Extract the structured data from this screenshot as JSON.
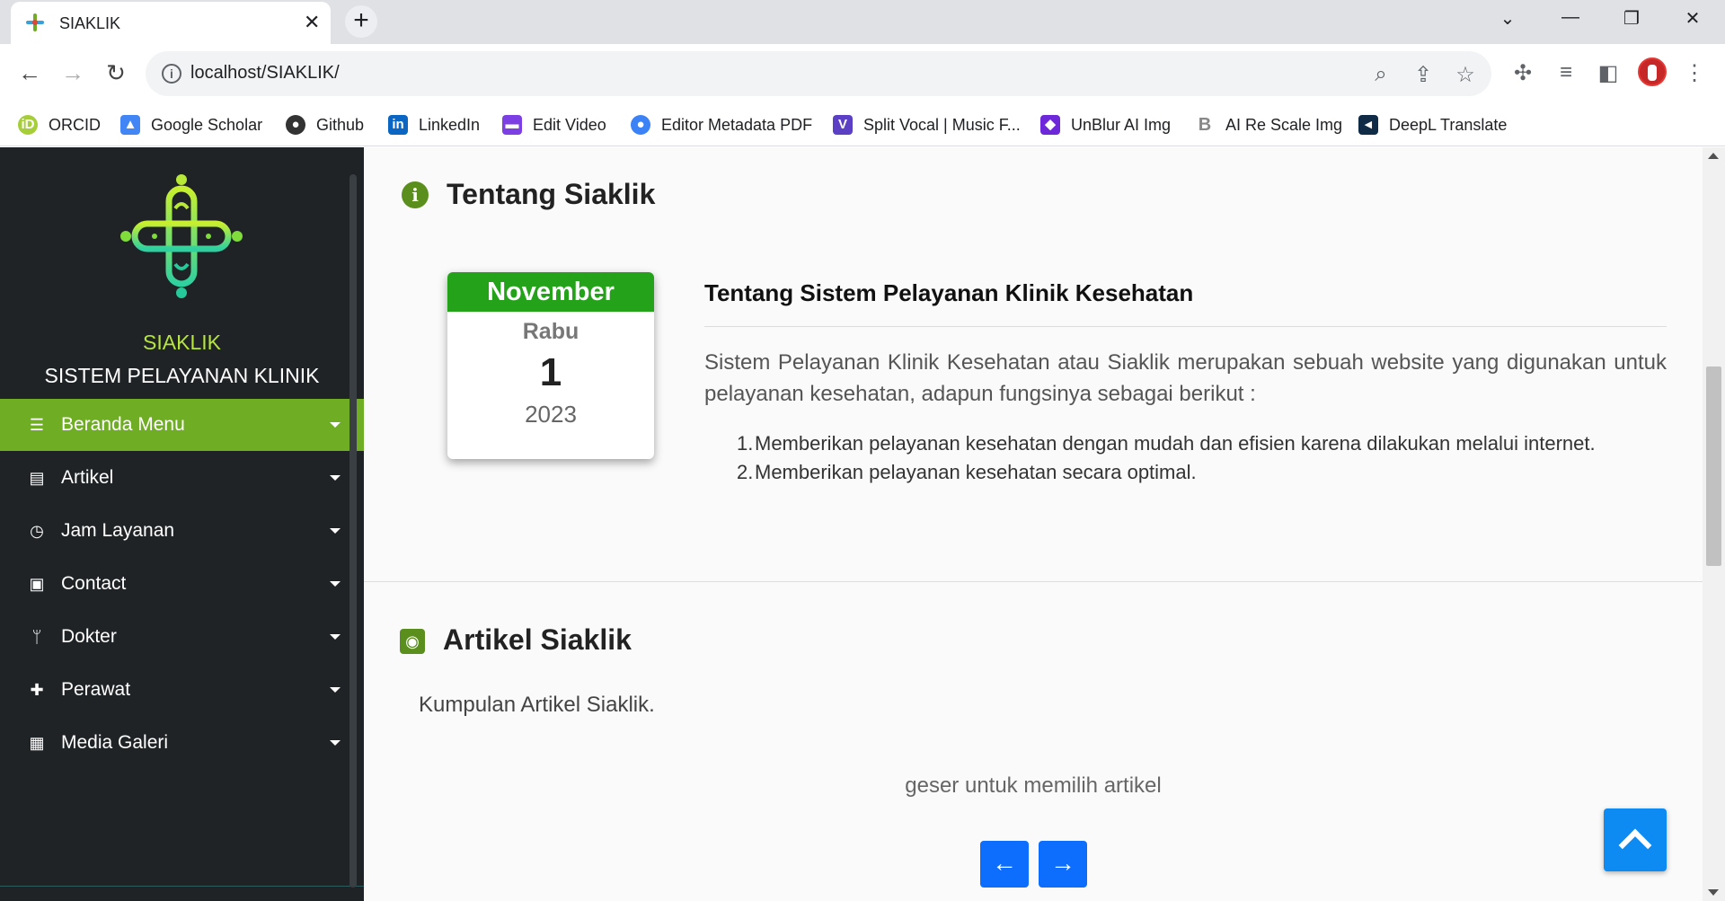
{
  "browser": {
    "tab_title": "SIAKLIK",
    "tab_close": "✕",
    "new_tab": "+",
    "url": "localhost/SIAKLIK/",
    "window_controls": {
      "minimize": "—",
      "restore": "❐",
      "close": "✕",
      "dropdown": "⌄"
    },
    "bookmarks": [
      {
        "label": "ORCID",
        "icon": "orcid-icon",
        "color": "#a6ce39"
      },
      {
        "label": "Google Scholar",
        "icon": "google-scholar-icon",
        "color": "#4285f4"
      },
      {
        "label": "Github",
        "icon": "github-icon",
        "color": "#333333"
      },
      {
        "label": "LinkedIn",
        "icon": "linkedin-icon",
        "color": "#0a66c2"
      },
      {
        "label": "Edit Video",
        "icon": "clapper-icon",
        "color": "#7b3fe4"
      },
      {
        "label": "Editor Metadata PDF",
        "icon": "people-icon",
        "color": "#3b82f6"
      },
      {
        "label": "Split Vocal | Music F...",
        "icon": "v-icon",
        "color": "#5b3fc4"
      },
      {
        "label": "UnBlur AI Img",
        "icon": "unblur-icon",
        "color": "#6d28d9"
      },
      {
        "label": "AI Re Scale Img",
        "icon": "b-icon",
        "color": "#9e9e9e"
      },
      {
        "label": "DeepL Translate",
        "icon": "deepl-icon",
        "color": "#0f2b46"
      }
    ]
  },
  "sidebar": {
    "brand_name": "SIAKLIK",
    "brand_sub": "SISTEM PELAYANAN KLINIK KESEHATAN",
    "accent": "#6fad25",
    "items": [
      {
        "label": "Beranda Menu",
        "icon": "list-icon",
        "glyph": "☰"
      },
      {
        "label": "Artikel",
        "icon": "newspaper-icon",
        "glyph": "▤"
      },
      {
        "label": "Jam Layanan",
        "icon": "clock-icon",
        "glyph": "◷"
      },
      {
        "label": "Contact",
        "icon": "contact-icon",
        "glyph": "▣"
      },
      {
        "label": "Dokter",
        "icon": "stethoscope-icon",
        "glyph": "ᛘ"
      },
      {
        "label": "Perawat",
        "icon": "medkit-icon",
        "glyph": "✚"
      },
      {
        "label": "Media Galeri",
        "icon": "images-icon",
        "glyph": "▦"
      }
    ]
  },
  "main": {
    "about_title": "Tentang Siaklik",
    "calendar": {
      "month": "November",
      "day": "Rabu",
      "date": "1",
      "year": "2023",
      "month_color": "#23a21a"
    },
    "about_heading": "Tentang Sistem Pelayanan Klinik Kesehatan",
    "about_text": "Sistem Pelayanan Klinik Kesehatan atau Siaklik merupakan sebuah website yang digunakan untuk pelayanan kesehatan, adapun fungsinya sebagai berikut :",
    "about_list": [
      {
        "num": "1.",
        "text": "Memberikan pelayanan kesehatan dengan mudah dan efisien karena dilakukan melalui internet."
      },
      {
        "num": "2.",
        "text": "Memberikan pelayanan kesehatan secara optimal."
      }
    ],
    "articles_title": "Artikel Siaklik",
    "articles_desc": "Kumpulan Artikel Siaklik.",
    "swipe_hint": "geser untuk memilih artikel",
    "prev_glyph": "←",
    "next_glyph": "→",
    "button_color": "#0d6efd"
  }
}
